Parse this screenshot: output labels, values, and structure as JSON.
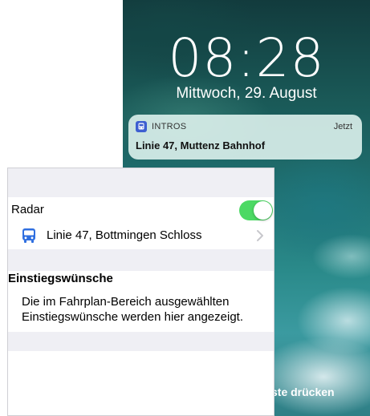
{
  "lockscreen": {
    "time": "08:28",
    "date": "Mittwoch, 29. August",
    "hint": "ste drücken",
    "notification": {
      "app_name": "INTROS",
      "time": "Jetzt",
      "title": "Linie 47, Muttenz Bahnhof",
      "app_icon": "bus-icon",
      "app_icon_color": "#3d5fd1"
    }
  },
  "settings": {
    "radar_label": "Radar",
    "radar_enabled": true,
    "toggle_color": "#4cd964",
    "line_item_label": "Linie 47, Bottmingen Schloss",
    "line_item_icon": "bus-icon",
    "line_item_icon_color": "#2f6fe0",
    "section_title": "Einstiegswünsche",
    "section_text": "Die im Fahrplan-Bereich ausgewählten Einstiegswünsche werden hier angezeigt."
  }
}
